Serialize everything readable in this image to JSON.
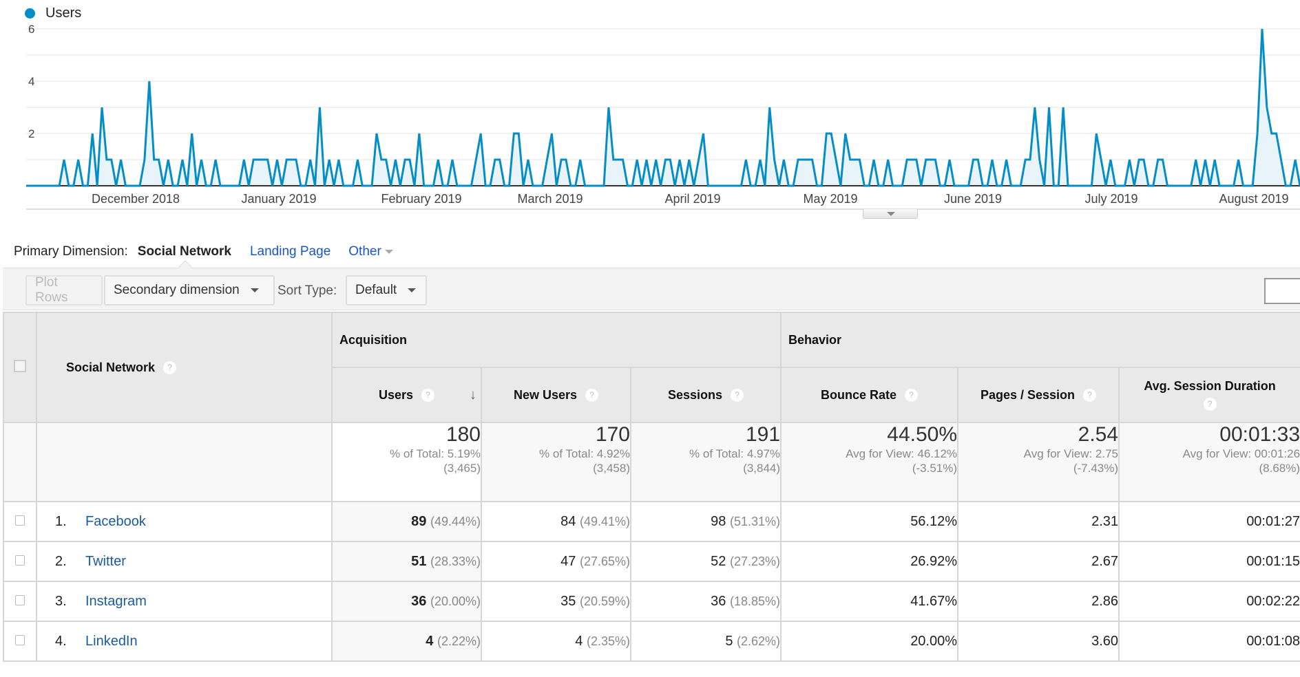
{
  "chart": {
    "legend": "Users",
    "color": "#058dc7"
  },
  "chart_data": {
    "type": "area",
    "series": [
      {
        "name": "Users",
        "values": [
          0,
          0,
          0,
          0,
          0,
          0,
          0,
          0,
          1,
          0,
          0,
          1,
          0,
          0,
          2,
          0,
          3,
          1,
          1,
          0,
          1,
          0,
          0,
          0,
          0,
          1,
          4,
          1,
          1,
          0,
          1,
          0,
          0,
          1,
          0,
          2,
          0,
          1,
          0,
          0,
          1,
          0,
          0,
          0,
          0,
          0,
          1,
          0,
          1,
          1,
          1,
          1,
          0,
          1,
          0,
          1,
          1,
          1,
          0,
          0,
          1,
          0,
          3,
          0,
          1,
          0,
          1,
          0,
          0,
          0,
          1,
          0,
          0,
          0,
          2,
          1,
          1,
          0,
          1,
          0,
          1,
          1,
          0,
          2,
          0,
          0,
          0,
          1,
          0,
          0,
          1,
          0,
          0,
          0,
          0,
          1,
          2,
          0,
          0,
          1,
          1,
          0,
          0,
          2,
          2,
          0,
          1,
          0,
          0,
          0,
          1,
          2,
          0,
          1,
          1,
          0,
          0,
          1,
          0,
          0,
          0,
          0,
          0,
          3,
          1,
          1,
          1,
          0,
          0,
          1,
          0,
          1,
          0,
          1,
          0,
          1,
          1,
          0,
          1,
          0,
          1,
          0,
          1,
          2,
          0,
          0,
          0,
          0,
          0,
          0,
          0,
          0,
          1,
          0,
          0,
          1,
          0,
          3,
          1,
          0,
          1,
          0,
          0,
          1,
          1,
          1,
          1,
          0,
          0,
          2,
          2,
          1,
          0,
          2,
          1,
          1,
          1,
          0,
          0,
          1,
          0,
          0,
          1,
          0,
          0,
          0,
          1,
          1,
          1,
          0,
          1,
          1,
          1,
          0,
          0,
          1,
          0,
          0,
          0,
          0,
          1,
          1,
          0,
          0,
          1,
          0,
          0,
          1,
          0,
          0,
          0,
          1,
          1,
          3,
          1,
          0,
          3,
          0,
          0,
          3,
          0,
          0,
          0,
          0,
          0,
          0,
          2,
          1,
          0,
          1,
          0,
          0,
          0,
          1,
          0,
          1,
          1,
          0,
          0,
          1,
          1,
          0,
          0,
          0,
          0,
          0,
          0,
          1,
          0,
          1,
          0,
          1,
          0,
          0,
          0,
          0,
          1,
          0,
          0,
          0,
          2,
          6,
          3,
          2,
          2,
          1,
          0,
          0,
          1,
          0
        ]
      }
    ],
    "x_tick_labels": [
      "December 2018",
      "January 2019",
      "February 2019",
      "March 2019",
      "April 2019",
      "May 2019",
      "June 2019",
      "July 2019",
      "August 2019"
    ],
    "y_tick_labels": [
      "2",
      "4",
      "6"
    ],
    "ylim": [
      0,
      6
    ],
    "grid": true,
    "legend": "top-left"
  },
  "dimension": {
    "label": "Primary Dimension:",
    "active": "Social Network",
    "options": [
      "Landing Page",
      "Other"
    ]
  },
  "toolbar": {
    "plot_rows": "Plot Rows",
    "secondary_dimension": "Secondary dimension",
    "sort_type_label": "Sort Type:",
    "sort_type_value": "Default"
  },
  "table": {
    "dim_header": "Social Network",
    "groups": [
      "Acquisition",
      "Behavior"
    ],
    "columns": [
      "Users",
      "New Users",
      "Sessions",
      "Bounce Rate",
      "Pages / Session",
      "Avg. Session Duration"
    ],
    "totals": [
      {
        "value": "180",
        "line1": "% of Total: 5.19%",
        "line2": "(3,465)"
      },
      {
        "value": "170",
        "line1": "% of Total: 4.92%",
        "line2": "(3,458)"
      },
      {
        "value": "191",
        "line1": "% of Total: 4.97%",
        "line2": "(3,844)"
      },
      {
        "value": "44.50%",
        "line1": "Avg for View: 46.12%",
        "line2": "(-3.51%)"
      },
      {
        "value": "2.54",
        "line1": "Avg for View: 2.75",
        "line2": "(-7.43%)"
      },
      {
        "value": "00:01:33",
        "line1": "Avg for View: 00:01:26",
        "line2": "(8.68%)"
      }
    ],
    "rows": [
      {
        "idx": "1.",
        "name": "Facebook",
        "users": "89",
        "users_pct": "(49.44%)",
        "new_users": "84",
        "new_users_pct": "(49.41%)",
        "sessions": "98",
        "sessions_pct": "(51.31%)",
        "bounce": "56.12%",
        "pages": "2.31",
        "duration": "00:01:27"
      },
      {
        "idx": "2.",
        "name": "Twitter",
        "users": "51",
        "users_pct": "(28.33%)",
        "new_users": "47",
        "new_users_pct": "(27.65%)",
        "sessions": "52",
        "sessions_pct": "(27.23%)",
        "bounce": "26.92%",
        "pages": "2.67",
        "duration": "00:01:15"
      },
      {
        "idx": "3.",
        "name": "Instagram",
        "users": "36",
        "users_pct": "(20.00%)",
        "new_users": "35",
        "new_users_pct": "(20.59%)",
        "sessions": "36",
        "sessions_pct": "(18.85%)",
        "bounce": "41.67%",
        "pages": "2.86",
        "duration": "00:02:22"
      },
      {
        "idx": "4.",
        "name": "LinkedIn",
        "users": "4",
        "users_pct": "(2.22%)",
        "new_users": "4",
        "new_users_pct": "(2.35%)",
        "sessions": "5",
        "sessions_pct": "(2.62%)",
        "bounce": "20.00%",
        "pages": "3.60",
        "duration": "00:01:08"
      }
    ]
  }
}
